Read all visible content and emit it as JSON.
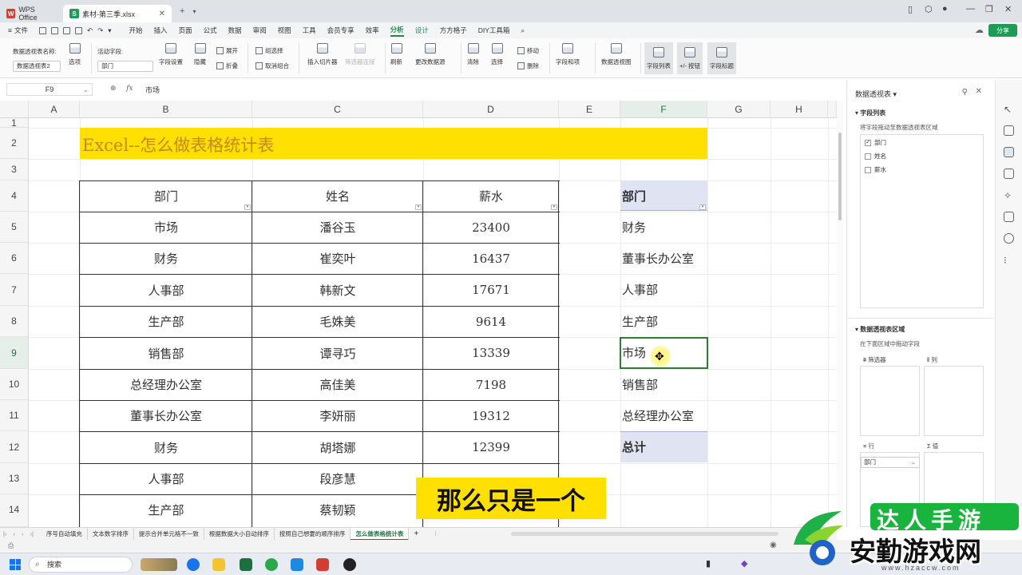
{
  "titlebar": {
    "wps_tab": "WPS Office",
    "doc_tab": "素材-第三季.xlsx",
    "add_tab": "+"
  },
  "menubar": {
    "file": "文件",
    "items": [
      "开始",
      "插入",
      "页面",
      "公式",
      "数据",
      "审阅",
      "视图",
      "工具",
      "会员专享",
      "效率",
      "分析",
      "设计",
      "方方格子",
      "DIY工具箱"
    ],
    "active": "分析",
    "share": "分享"
  },
  "ribbon": {
    "pivot_name_label": "数据透视表名称:",
    "pivot_name_value": "数据透视表2",
    "options_label": "选项",
    "active_field_label": "活动字段:",
    "active_field_value": "部门",
    "field_settings": "字段设置",
    "hide": "隐藏",
    "expand": "展开",
    "collapse": "折叠",
    "group_selection": "组选择",
    "ungroup": "取消组合",
    "insert_slicer": "插入切片器",
    "filter_connections": "筛选器连接",
    "refresh": "刷新",
    "change_source": "更改数据源",
    "clear": "清除",
    "select": "选择",
    "move": "移动",
    "delete": "删除",
    "fields_items": "字段和项",
    "pivot_chart": "数据透视图",
    "field_list": "字段列表",
    "plus_minus": "+/- 按钮",
    "field_headers": "字段标题"
  },
  "formulabar": {
    "cell_ref": "F9",
    "fx": "fx",
    "value": "市场"
  },
  "grid": {
    "columns": [
      "A",
      "B",
      "C",
      "D",
      "E",
      "F",
      "G",
      "H"
    ],
    "rows": [
      "1",
      "2",
      "3",
      "4",
      "5",
      "6",
      "7",
      "8",
      "9",
      "10",
      "11",
      "12",
      "13",
      "14"
    ],
    "title": "Excel--怎么做表格统计表",
    "table_headers": [
      "部门",
      "姓名",
      "薪水"
    ],
    "table_rows": [
      [
        "市场",
        "潘谷玉",
        "23400"
      ],
      [
        "财务",
        "崔奕叶",
        "16437"
      ],
      [
        "人事部",
        "韩新文",
        "17671"
      ],
      [
        "生产部",
        "毛姝美",
        "9614"
      ],
      [
        "销售部",
        "谭寻巧",
        "13339"
      ],
      [
        "总经理办公室",
        "高佳美",
        "7198"
      ],
      [
        "董事长办公室",
        "李妍丽",
        "19312"
      ],
      [
        "财务",
        "胡塔娜",
        "12399"
      ],
      [
        "人事部",
        "段彦慧",
        ""
      ],
      [
        "生产部",
        "蔡韧颖",
        ""
      ]
    ],
    "pivot_header": "部门",
    "pivot_items": [
      "财务",
      "董事长办公室",
      "人事部",
      "生产部",
      "市场",
      "销售部",
      "总经理办公室"
    ],
    "pivot_total": "总计",
    "subtitle": "那么只是一个"
  },
  "right_panel": {
    "title": "数据透视表 ▾",
    "field_list_label": "字段列表",
    "field_hint": "将字段拖动至数据透视表区域",
    "fields": [
      {
        "name": "部门",
        "checked": true
      },
      {
        "name": "姓名",
        "checked": false
      },
      {
        "name": "薪水",
        "checked": false
      }
    ],
    "areas_label": "数据透视表区域",
    "areas_hint": "在下面区域中拖动字段",
    "filter_label": "筛选器",
    "columns_label": "列",
    "rows_label": "行",
    "values_label": "值",
    "row_item": "部门"
  },
  "sheet_tabs": {
    "tabs": [
      "序号自动填充",
      "文本数字排序",
      "提示合并单元格不一致",
      "根据数据大小自动排序",
      "按照自己想要的顺序排序",
      "怎么做表格统计表"
    ],
    "active": "怎么做表格统计表",
    "add": "+"
  },
  "taskbar": {
    "search": "搜索"
  },
  "watermark": {
    "top": "达人手游",
    "main": "安勤游戏网",
    "url": "www.hzaccw.com"
  },
  "colors": {
    "accent": "#1f9b57",
    "title_band": "#ffe000",
    "pivot_header_bg": "#dfe3f2"
  }
}
